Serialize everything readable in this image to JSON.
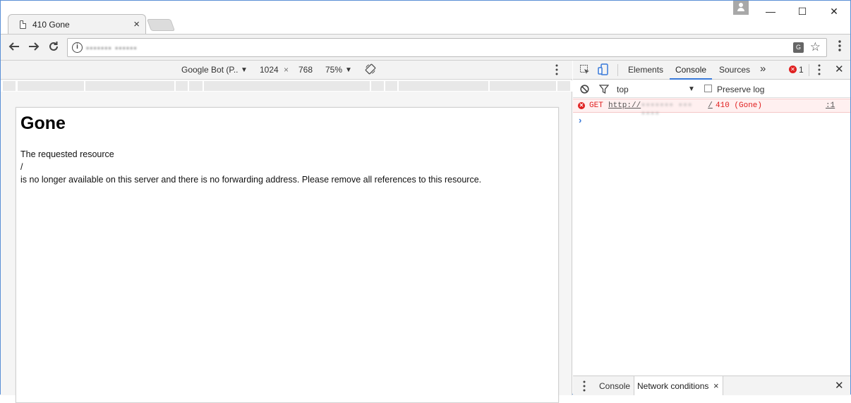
{
  "browser": {
    "tab_title": "410 Gone",
    "tab_close": "×",
    "window_controls": {
      "minimize": "—",
      "maximize": "☐",
      "close": "✕"
    },
    "url_display": "▪▪▪▪▪▪▪ ▪▪▪▪▪▪"
  },
  "device_toolbar": {
    "device": "Google Bot (P..",
    "width": "1024",
    "times": "×",
    "height": "768",
    "zoom": "75%"
  },
  "page": {
    "heading": "Gone",
    "line1": "The requested resource",
    "line2": "/",
    "line3": "is no longer available on this server and there is no forwarding address. Please remove all references to this resource."
  },
  "devtools": {
    "tabs": [
      "Elements",
      "Console",
      "Sources"
    ],
    "more": "»",
    "error_count": "1",
    "context": "top",
    "preserve_log_label": "Preserve log",
    "error": {
      "method": "GET",
      "url_prefix": "http://",
      "url_hidden": "▪▪▪▪▪▪▪ ▪▪▪ ▪▪▪▪",
      "url_suffix": "/",
      "status": "410 (Gone)",
      "location": ":1"
    },
    "prompt": "›",
    "drawer_tabs": [
      "Console",
      "Network conditions"
    ],
    "drawer_tab_close": "×"
  },
  "colors": {
    "accent": "#3879d9",
    "error": "#e02020",
    "error_bg": "#fff0f0"
  }
}
